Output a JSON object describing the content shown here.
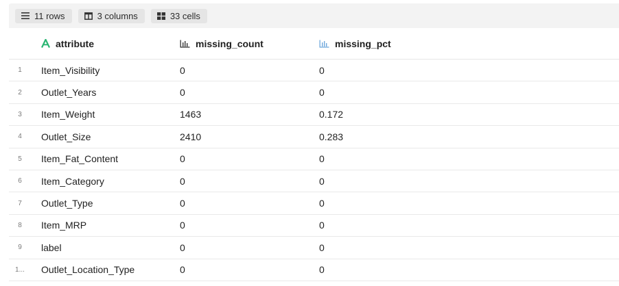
{
  "toolbar": {
    "rows_label": "11 rows",
    "columns_label": "3 columns",
    "cells_label": "33 cells"
  },
  "columns": [
    {
      "name": "attribute",
      "icon": "text-type-icon",
      "icon_color": "#2bb673"
    },
    {
      "name": "missing_count",
      "icon": "bar-chart-icon",
      "icon_color": "#333333"
    },
    {
      "name": "missing_pct",
      "icon": "bar-chart-icon",
      "icon_color": "#6fa8dc"
    }
  ],
  "rows": [
    {
      "index": "1",
      "attribute": "Item_Visibility",
      "missing_count": "0",
      "missing_pct": "0"
    },
    {
      "index": "2",
      "attribute": "Outlet_Years",
      "missing_count": "0",
      "missing_pct": "0"
    },
    {
      "index": "3",
      "attribute": "Item_Weight",
      "missing_count": "1463",
      "missing_pct": "0.172"
    },
    {
      "index": "4",
      "attribute": "Outlet_Size",
      "missing_count": "2410",
      "missing_pct": "0.283"
    },
    {
      "index": "5",
      "attribute": "Item_Fat_Content",
      "missing_count": "0",
      "missing_pct": "0"
    },
    {
      "index": "6",
      "attribute": "Item_Category",
      "missing_count": "0",
      "missing_pct": "0"
    },
    {
      "index": "7",
      "attribute": "Outlet_Type",
      "missing_count": "0",
      "missing_pct": "0"
    },
    {
      "index": "8",
      "attribute": "Item_MRP",
      "missing_count": "0",
      "missing_pct": "0"
    },
    {
      "index": "9",
      "attribute": "label",
      "missing_count": "0",
      "missing_pct": "0"
    },
    {
      "index": "1...",
      "attribute": "Outlet_Location_Type",
      "missing_count": "0",
      "missing_pct": "0"
    }
  ]
}
